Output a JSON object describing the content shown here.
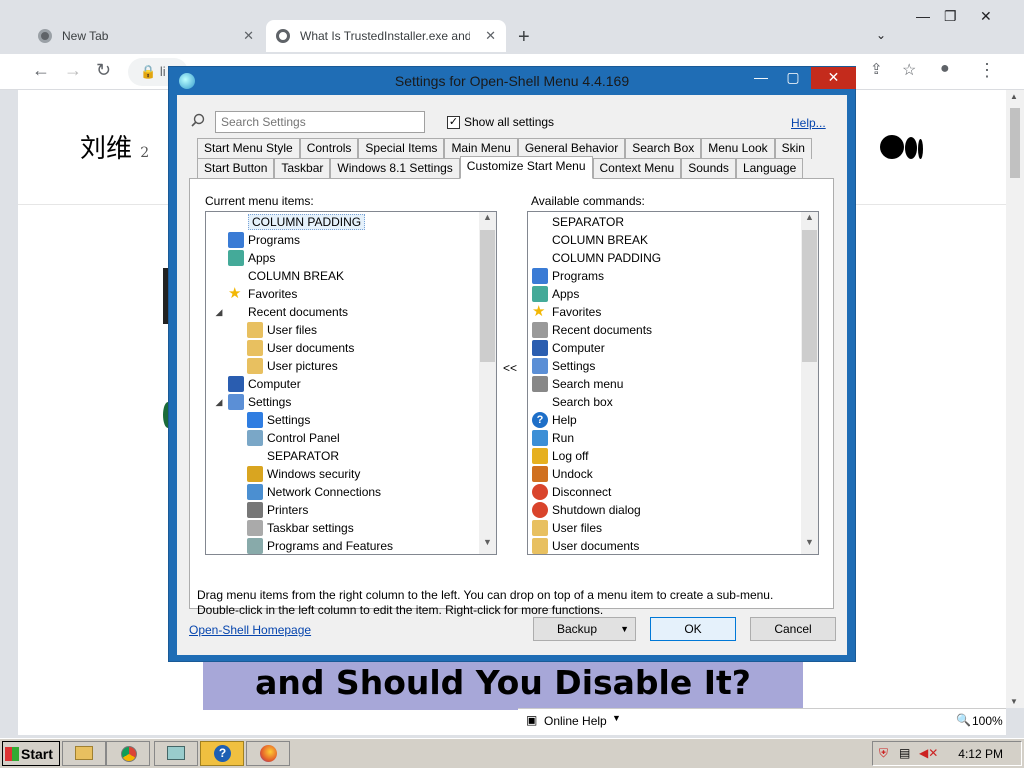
{
  "browser": {
    "tabs": [
      {
        "label": "New Tab"
      },
      {
        "label": "What Is TrustedInstaller.exe and"
      }
    ],
    "new_tab": "+",
    "address_fragment": "li",
    "author": "刘维",
    "author_suffix": "2",
    "banner": "and Should You Disable It?",
    "status": {
      "help_label": "Online Help",
      "zoom": "100%"
    }
  },
  "dialog": {
    "title": "Settings for Open-Shell Menu 4.4.169",
    "search_placeholder": "Search Settings",
    "show_all_label": "Show all settings",
    "show_all_checked": "✓",
    "help_link": "Help...",
    "tabs_row1": [
      "Start Menu Style",
      "Controls",
      "Special Items",
      "Main Menu",
      "General Behavior",
      "Search Box",
      "Menu Look",
      "Skin"
    ],
    "tabs_row2": [
      "Start Button",
      "Taskbar",
      "Windows 8.1 Settings",
      "Customize Start Menu",
      "Context Menu",
      "Sounds",
      "Language"
    ],
    "current_label": "Current menu items:",
    "available_label": "Available commands:",
    "move_button": "<<",
    "current_items": [
      {
        "label": "COLUMN PADDING",
        "icon": "none",
        "indent": 0,
        "exp": ""
      },
      {
        "label": "Programs",
        "icon": "programs-icon",
        "indent": 0,
        "exp": ""
      },
      {
        "label": "Apps",
        "icon": "apps-icon",
        "indent": 0,
        "exp": ""
      },
      {
        "label": "COLUMN BREAK",
        "icon": "none",
        "indent": 0,
        "exp": ""
      },
      {
        "label": "Favorites",
        "icon": "favorites-icon",
        "indent": 0,
        "exp": ""
      },
      {
        "label": "Recent documents",
        "icon": "none",
        "indent": 0,
        "exp": "◢"
      },
      {
        "label": "User files",
        "icon": "folder-icon",
        "indent": 1,
        "exp": ""
      },
      {
        "label": "User documents",
        "icon": "folder-icon",
        "indent": 1,
        "exp": ""
      },
      {
        "label": "User pictures",
        "icon": "folder-icon",
        "indent": 1,
        "exp": ""
      },
      {
        "label": "Computer",
        "icon": "computer-icon",
        "indent": 0,
        "exp": ""
      },
      {
        "label": "Settings",
        "icon": "settings-icon",
        "indent": 0,
        "exp": "◢"
      },
      {
        "label": "Settings",
        "icon": "gear-icon",
        "indent": 1,
        "exp": ""
      },
      {
        "label": "Control Panel",
        "icon": "control-panel-icon",
        "indent": 1,
        "exp": ""
      },
      {
        "label": "SEPARATOR",
        "icon": "none",
        "indent": 1,
        "exp": ""
      },
      {
        "label": "Windows security",
        "icon": "lock-icon",
        "indent": 1,
        "exp": ""
      },
      {
        "label": "Network Connections",
        "icon": "network-icon",
        "indent": 1,
        "exp": ""
      },
      {
        "label": "Printers",
        "icon": "printer-icon",
        "indent": 1,
        "exp": ""
      },
      {
        "label": "Taskbar settings",
        "icon": "checklist-icon",
        "indent": 1,
        "exp": ""
      },
      {
        "label": "Programs and Features",
        "icon": "programs-features-icon",
        "indent": 1,
        "exp": ""
      }
    ],
    "available_items": [
      {
        "label": "SEPARATOR",
        "icon": "none"
      },
      {
        "label": "COLUMN BREAK",
        "icon": "none"
      },
      {
        "label": "COLUMN PADDING",
        "icon": "none"
      },
      {
        "label": "Programs",
        "icon": "programs-icon"
      },
      {
        "label": "Apps",
        "icon": "apps-icon"
      },
      {
        "label": "Favorites",
        "icon": "favorites-icon"
      },
      {
        "label": "Recent documents",
        "icon": "recent-icon"
      },
      {
        "label": "Computer",
        "icon": "computer-icon"
      },
      {
        "label": "Settings",
        "icon": "settings-icon"
      },
      {
        "label": "Search menu",
        "icon": "search-icon"
      },
      {
        "label": "Search box",
        "icon": "none"
      },
      {
        "label": "Help",
        "icon": "help-icon"
      },
      {
        "label": "Run",
        "icon": "run-icon"
      },
      {
        "label": "Log off",
        "icon": "logoff-icon"
      },
      {
        "label": "Undock",
        "icon": "undock-icon"
      },
      {
        "label": "Disconnect",
        "icon": "disconnect-icon"
      },
      {
        "label": "Shutdown dialog",
        "icon": "shutdown-icon"
      },
      {
        "label": "User files",
        "icon": "folder-icon"
      },
      {
        "label": "User documents",
        "icon": "folder-icon"
      }
    ],
    "hint_line1": "Drag menu items from the right column to the left. You can drop on top of a menu item to create a sub-menu.",
    "hint_line2": "Double-click in the left column to edit the item. Right-click for more functions.",
    "homepage_link": "Open-Shell Homepage",
    "backup_label": "Backup",
    "ok_label": "OK",
    "cancel_label": "Cancel"
  },
  "taskbar": {
    "start_label": "Start",
    "clock": "4:12 PM"
  }
}
